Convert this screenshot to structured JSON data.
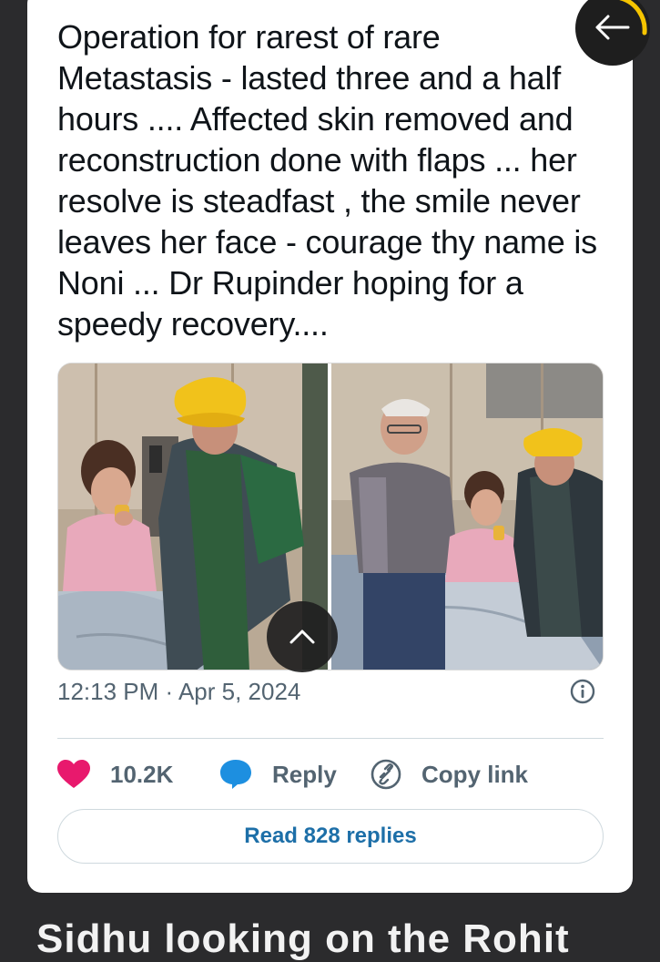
{
  "tweet": {
    "text": "Operation for rarest of rare Metastasis - lasted three and a half hours .... Affected skin removed and reconstruction done with flaps ... her resolve is steadfast , the smile never leaves her face - courage thy name is Noni ... Dr Rupinder hoping for a speedy recovery....",
    "timestamp": "12:13 PM · Apr 5, 2024"
  },
  "actions": {
    "like_count": "10.2K",
    "reply_label": "Reply",
    "copy_label": "Copy link"
  },
  "read_replies_label": "Read 828 replies",
  "next_post_headline": "Sidhu looking on the Rohit",
  "icons": {
    "like": "heart-icon",
    "reply": "speech-bubble-icon",
    "copy": "link-icon",
    "info": "info-icon",
    "back": "arrow-left-icon",
    "scroll": "chevron-up-icon"
  },
  "colors": {
    "like": "#e8196d",
    "reply": "#1d8fe0",
    "link_text": "#1d6fa8",
    "back_ring": "#f5c400"
  }
}
